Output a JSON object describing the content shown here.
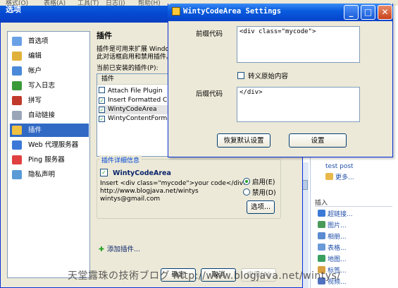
{
  "background_app": {
    "menu": [
      "格式(O)",
      "表格(A)",
      "工具(T)",
      "日志(J)",
      "帮助(H)"
    ],
    "sidebar_links": [
      {
        "label": "test post",
        "icon": ""
      },
      {
        "label": "更多...",
        "icon": "folder-icon"
      }
    ],
    "insert_heading": "插入",
    "insert_items": [
      {
        "label": "超链接...",
        "icon": "hyperlink-icon"
      },
      {
        "label": "图片...",
        "icon": "picture-icon"
      },
      {
        "label": "相册...",
        "icon": "album-icon"
      },
      {
        "label": "表格...",
        "icon": "table-icon"
      },
      {
        "label": "地图...",
        "icon": "map-icon"
      },
      {
        "label": "标签...",
        "icon": "tag-icon"
      },
      {
        "label": "视频...",
        "icon": "video-icon"
      }
    ]
  },
  "options_dialog": {
    "title": "选项",
    "nav": [
      {
        "label": "首选项",
        "icon": "preferences-icon",
        "color": "#6aa0e6"
      },
      {
        "label": "编辑",
        "icon": "edit-icon",
        "color": "#e0b13a"
      },
      {
        "label": "帐户",
        "icon": "account-icon",
        "color": "#4a8ad8"
      },
      {
        "label": "写入日志",
        "icon": "write-log-icon",
        "color": "#3a9a3a"
      },
      {
        "label": "拼写",
        "icon": "abc-spell-icon",
        "color": "#c0392b"
      },
      {
        "label": "自动链接",
        "icon": "auto-link-icon",
        "color": "#9aa6b8"
      },
      {
        "label": "插件",
        "icon": "plugin-icon",
        "color": "#f0c040"
      },
      {
        "label": "Web 代理服务器",
        "icon": "web-proxy-icon",
        "color": "#3c78d8"
      },
      {
        "label": "Ping 服务器",
        "icon": "ping-icon",
        "color": "#e04040"
      },
      {
        "label": "隐私声明",
        "icon": "privacy-icon",
        "color": "#5a9ad6"
      }
    ],
    "selected_nav_index": 6,
    "heading": "插件",
    "description_line1": "插件是可用来扩展 Windows Live Writer 功能的程序。",
    "description_line2": "此对话框启用和禁用插件。",
    "installed_label": "当前已安装的插件(P):",
    "list_header": "插件",
    "plugins": [
      "Attach File Plugin",
      "Insert Formatted Clipboard",
      "WintyCodeArea",
      "WintyContentFormatter"
    ],
    "selected_plugin_index": 2,
    "details_title": "插件详细信息",
    "details_name": "WintyCodeArea",
    "details_description": "Insert <div class=\"mycode\">your code</div>",
    "details_url": "http://www.blogjava.net/wintys",
    "details_email": "wintys@gmail.com",
    "enable_label": "启用(E)",
    "disable_label": "禁用(D)",
    "enabled": true,
    "options_button": "选项...",
    "add_plugin": "添加插件...",
    "ok_button": "确定",
    "cancel_button": "取消",
    "apply_button": "应用(A)"
  },
  "settings_dialog": {
    "title": "WintyCodeArea Settings",
    "prefix_label": "前缀代码",
    "prefix_value": "<div class=\"mycode\">",
    "escape_label": "转义原始内容",
    "escape_checked": false,
    "suffix_label": "后缀代码",
    "suffix_value": "</div>",
    "restore_button": "恢复默认设置",
    "set_button": "设置"
  },
  "watermark": "天堂露珠の技術ブログ http://www.blogjava.net/wintys/",
  "colors": {
    "xp_blue": "#0a5ddf",
    "selection": "#316ac5",
    "dialog_face": "#ece9d8"
  }
}
